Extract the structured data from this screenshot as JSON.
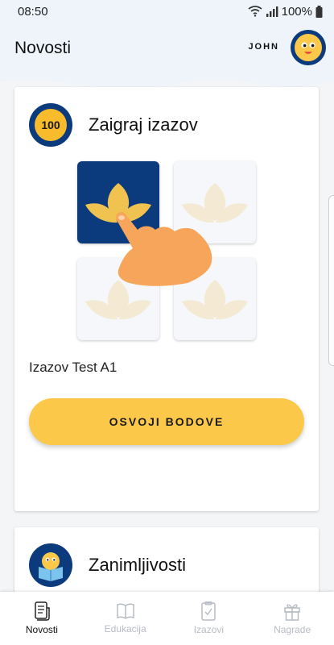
{
  "status": {
    "time": "08:50",
    "battery": "100%"
  },
  "header": {
    "title": "Novosti",
    "user_name": "JOHN"
  },
  "challenge_card": {
    "badge": "100",
    "title": "Zaigraj izazov",
    "test_name": "Izazov Test A1",
    "cta_label": "OSVOJI BODOVE"
  },
  "news_card": {
    "title": "Zanimljivosti"
  },
  "nav": {
    "items": [
      {
        "label": "Novosti",
        "icon": "newspaper-icon",
        "active": true
      },
      {
        "label": "Edukacija",
        "icon": "book-icon",
        "active": false
      },
      {
        "label": "Izazovi",
        "icon": "clipboard-check-icon",
        "active": false
      },
      {
        "label": "Nagrade",
        "icon": "gift-icon",
        "active": false
      }
    ]
  },
  "colors": {
    "brand_blue": "#0b3b7c",
    "accent_yellow": "#fcc84a",
    "leaf_gold": "#f0c24f",
    "leaf_faded": "#f4ead3"
  }
}
